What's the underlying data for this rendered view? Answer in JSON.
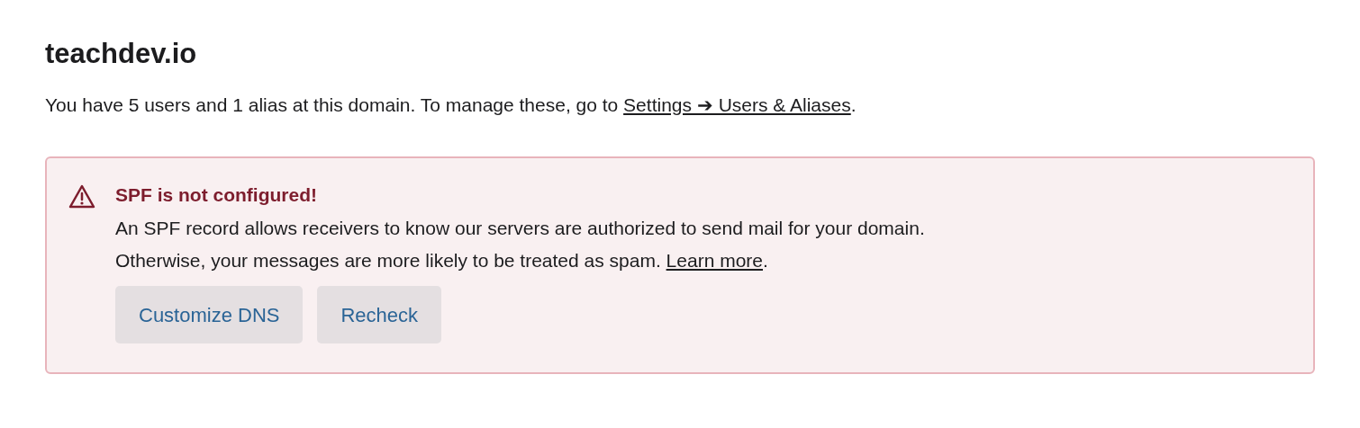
{
  "domain": {
    "title": "teachdev.io"
  },
  "summary": {
    "text": "You have 5 users and 1 alias at this domain. To manage these, go to ",
    "link": "Settings ➔ Users & Aliases",
    "after": "."
  },
  "alert": {
    "kind": "error",
    "title": "SPF is not configured!",
    "line_1": "An SPF record allows receivers to know our servers are authorized to send mail for your domain.",
    "line_2": {
      "text": "Otherwise, your messages are more likely to be treated as spam. ",
      "link": "Learn more",
      "after": "."
    },
    "buttons": [
      "Customize DNS",
      "Recheck"
    ]
  }
}
